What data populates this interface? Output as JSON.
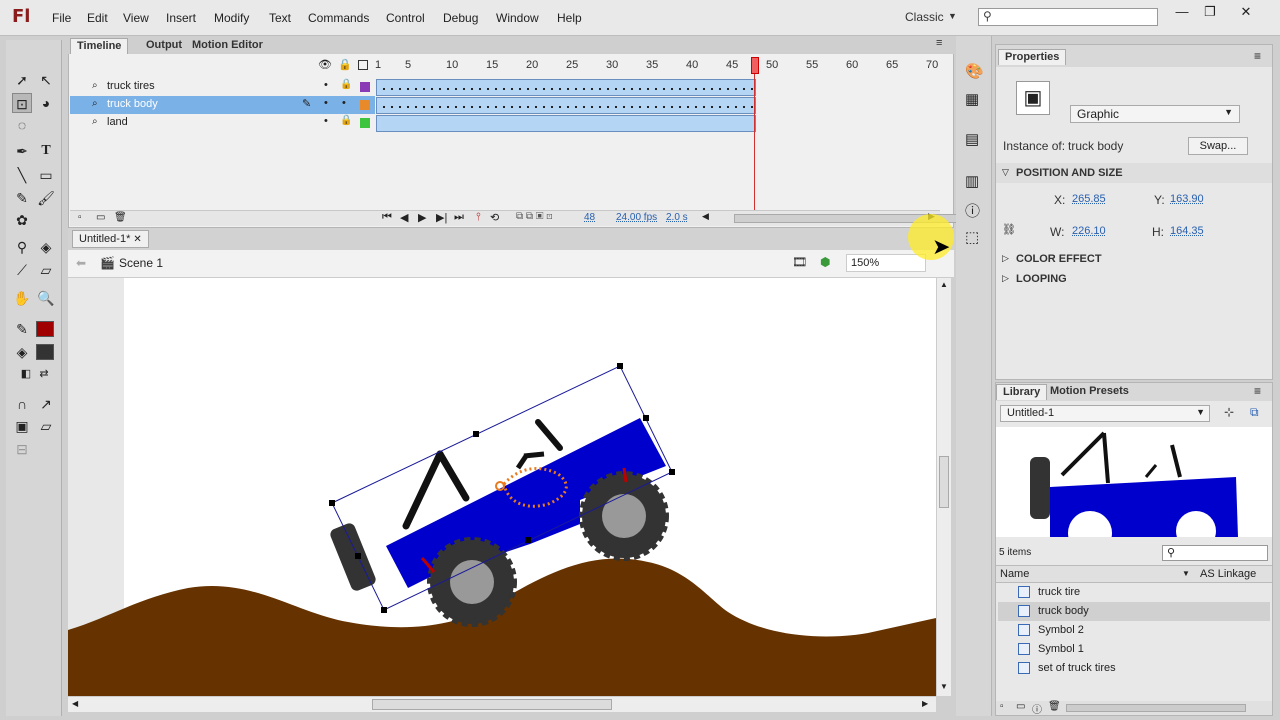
{
  "app": {
    "logo": "Fl",
    "workspace": "Classic"
  },
  "menu": [
    "File",
    "Edit",
    "View",
    "Insert",
    "Modify",
    "Text",
    "Commands",
    "Control",
    "Debug",
    "Window",
    "Help"
  ],
  "timeline": {
    "tabs": [
      "Timeline",
      "Output",
      "Motion Editor"
    ],
    "layers": [
      {
        "name": "truck tires",
        "color": "#8a3ab5"
      },
      {
        "name": "truck body",
        "color": "#e88a2a"
      },
      {
        "name": "land",
        "color": "#3fc43f"
      }
    ],
    "frame_numbers": [
      "1",
      "5",
      "10",
      "15",
      "20",
      "25",
      "30",
      "35",
      "40",
      "45",
      "50",
      "55",
      "60",
      "65",
      "70"
    ],
    "current_frame": "48",
    "fps": "24.00 fps",
    "time": "2.0 s"
  },
  "document": {
    "title": "Untitled-1*",
    "scene": "Scene 1",
    "zoom": "150%"
  },
  "properties": {
    "tab": "Properties",
    "type": "Graphic",
    "instance_label": "Instance of:",
    "instance": "truck body",
    "swap": "Swap...",
    "section_pos": "POSITION AND SIZE",
    "x_label": "X:",
    "x": "265.85",
    "y_label": "Y:",
    "y": "163.90",
    "w_label": "W:",
    "w": "226.10",
    "h_label": "H:",
    "h": "164.35",
    "section_color": "COLOR EFFECT",
    "section_loop": "LOOPING"
  },
  "library": {
    "tabs": [
      "Library",
      "Motion Presets"
    ],
    "file": "Untitled-1",
    "count": "5 items",
    "col_name": "Name",
    "col_link": "AS Linkage",
    "items": [
      "truck tire",
      "truck body",
      "Symbol 2",
      "Symbol 1",
      "set of truck tires"
    ]
  },
  "colors": {
    "stroke": "#8b0000",
    "fill": "#333333",
    "accent": "#2860b0"
  }
}
